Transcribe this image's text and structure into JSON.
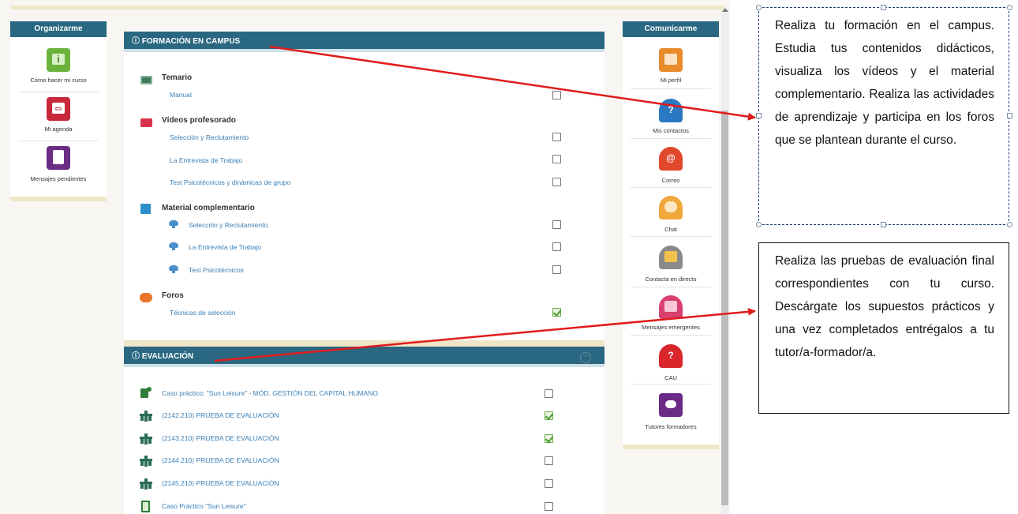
{
  "left_panel": {
    "title": "Organizarme",
    "items": [
      {
        "label": "Cómo hacer mi curso",
        "icon": "info-icon",
        "color": "#6cb33e"
      },
      {
        "label": "Mi agenda",
        "icon": "calendar-icon",
        "color": "#c8283a"
      },
      {
        "label": "Mensajes pendientes",
        "icon": "document-icon",
        "color": "#6b2c83"
      }
    ]
  },
  "right_panel": {
    "title": "Comunicarme",
    "items": [
      {
        "label": "Mi perfil",
        "icon": "profile-icon",
        "color": "#e88b2a"
      },
      {
        "label": "Mis contactos",
        "icon": "contacts-icon",
        "color": "#2b78c2"
      },
      {
        "label": "Correo",
        "icon": "mail-icon",
        "color": "#e0472b"
      },
      {
        "label": "Chat",
        "icon": "chat-icon",
        "color": "#f0a83a"
      },
      {
        "label": "Contacta en directo",
        "icon": "live-contact-icon",
        "color": "#8a8a8a"
      },
      {
        "label": "Mensajes emergentes",
        "icon": "popup-messages-icon",
        "color": "#d8406f"
      },
      {
        "label": "CAU",
        "icon": "help-icon",
        "color": "#d9262b"
      },
      {
        "label": "Tutores formadores",
        "icon": "tutors-icon",
        "color": "#6a2a86"
      }
    ]
  },
  "campus": {
    "header": "ⓘ FORMACIÓN EN CAMPUS",
    "categories": [
      {
        "name": "Temario",
        "icon": "book-icon",
        "items": [
          {
            "label": "Manual",
            "checked": false
          }
        ]
      },
      {
        "name": "Vídeos profesorado",
        "icon": "video-icon",
        "items": [
          {
            "label": "Selección y Reclutamiento",
            "checked": false
          },
          {
            "label": "La Entrevista de Trabajo",
            "checked": false
          },
          {
            "label": "Test Psicotécnicos y dinámicas de grupo",
            "checked": false
          }
        ]
      },
      {
        "name": "Material complementario",
        "icon": "folder-icon",
        "items": [
          {
            "label": "Selección y Reclutamiento.",
            "checked": false
          },
          {
            "label": "La Entrevista de Trabajo",
            "checked": false
          },
          {
            "label": "Test Psicotécnicos",
            "checked": false
          }
        ]
      },
      {
        "name": "Foros",
        "icon": "forum-icon",
        "items": [
          {
            "label": "Técnicas de selección",
            "checked": true
          }
        ]
      }
    ]
  },
  "evaluation": {
    "header": "ⓘ EVALUACIÓN",
    "collapse_glyph": "⌃",
    "items": [
      {
        "label": "Caso práctico: \"Sun Leisure\" - MÓD. GESTIÓN DEL CAPITAL HUMANO",
        "checked": false,
        "icon": "case-study-icon"
      },
      {
        "label": "(2142.210) PRUEBA DE EVALUACIÓN",
        "checked": true,
        "icon": "exam-icon"
      },
      {
        "label": "(2143.210) PRUEBA DE EVALUACIÓN",
        "checked": true,
        "icon": "exam-icon"
      },
      {
        "label": "(2144.210) PRUEBA DE EVALUACIÓN",
        "checked": false,
        "icon": "exam-icon"
      },
      {
        "label": "(2145.210) PRUEBA DE EVALUACIÓN",
        "checked": false,
        "icon": "exam-icon"
      },
      {
        "label": "Caso Práctico \"Sun Leisure\"",
        "checked": false,
        "icon": "clipboard-icon"
      }
    ]
  },
  "callouts": {
    "campus_text": "Realiza tu formación en el campus. Estudia tus contenidos didácticos, visualiza los vídeos y el material complementario. Realiza las actividades de aprendizaje y participa en los foros que se plantean durante el curso.",
    "evaluation_text": "Realiza las pruebas de evaluación final correspondientes con tu curso. Descárgate los supuestos prácticos y una vez completados entrégalos a tu tutor/a-formador/a."
  },
  "colors": {
    "header_blue": "#2a6781",
    "link_blue": "#3a7fb6",
    "arrow_red": "#e01b1b",
    "strip_beige": "#efe6c7"
  }
}
